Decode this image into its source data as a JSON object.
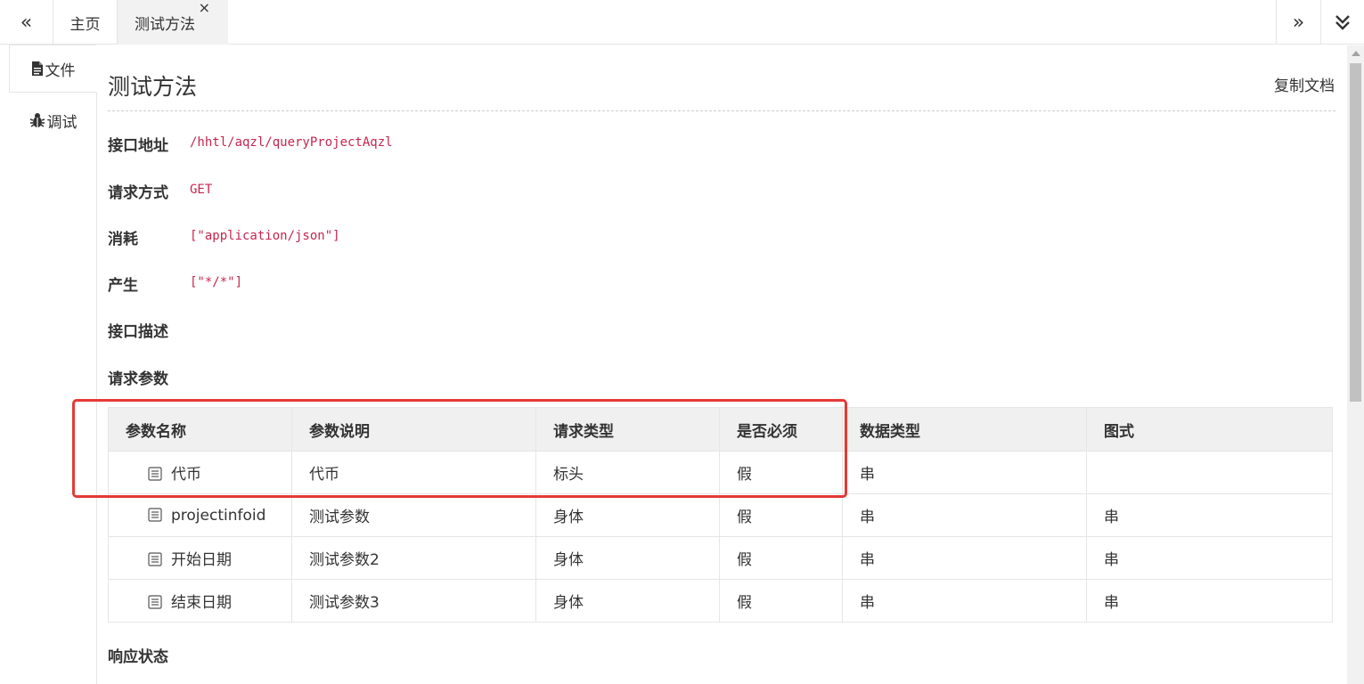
{
  "topbar": {
    "nav_left": "«",
    "nav_right": "»",
    "home_tab": "主页",
    "active_tab": "测试方法",
    "close": "×"
  },
  "sidebar": {
    "doc_label": "文件",
    "debug_label": "调试"
  },
  "main": {
    "title": "测试方法",
    "copy_doc": "复制文档",
    "fields": {
      "url_label": "接口地址",
      "url_value": "/hhtl/aqzl/queryProjectAqzl",
      "method_label": "请求方式",
      "method_value": "GET",
      "consumes_label": "消耗",
      "consumes_value": "[\"application/json\"]",
      "produces_label": "产生",
      "produces_value": "[\"*/*\"]",
      "desc_label": "接口描述",
      "params_label": "请求参数",
      "response_label": "响应状态"
    }
  },
  "params_table": {
    "headers": [
      "参数名称",
      "参数说明",
      "请求类型",
      "是否必须",
      "数据类型",
      "图式"
    ],
    "rows": [
      {
        "name": "代币",
        "desc": "代币",
        "in": "标头",
        "required": "假",
        "type": "串",
        "schema": ""
      },
      {
        "name": "projectinfoid",
        "desc": "测试参数",
        "in": "身体",
        "required": "假",
        "type": "串",
        "schema": "串"
      },
      {
        "name": "开始日期",
        "desc": "测试参数2",
        "in": "身体",
        "required": "假",
        "type": "串",
        "schema": "串"
      },
      {
        "name": "结束日期",
        "desc": "测试参数3",
        "in": "身体",
        "required": "假",
        "type": "串",
        "schema": "串"
      }
    ]
  },
  "colors": {
    "highlight": "#e53935",
    "header_type": "#e6a23c",
    "body_type": "#2a6fb0",
    "code": "#c7254e"
  }
}
